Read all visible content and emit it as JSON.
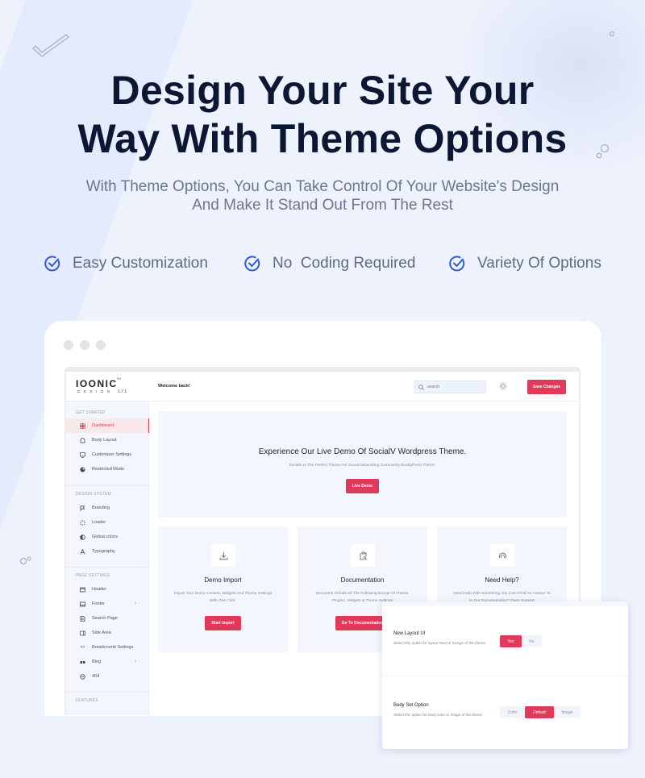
{
  "hero": {
    "title_line1": "Design Your Site Your",
    "title_line2": "Way With Theme Options",
    "subtitle_line1": "With Theme Options, You Can Take Control Of Your Website's Design",
    "subtitle_line2": "And Make It Stand Out From The Rest"
  },
  "features": [
    {
      "icon": "check-circle-icon",
      "label": "Easy Customization"
    },
    {
      "icon": "check-circle-icon",
      "label": "No  Coding Required"
    },
    {
      "icon": "check-circle-icon",
      "label": "Variety Of Options"
    }
  ],
  "colors": {
    "accent": "#e0395a",
    "feature_check": "#2d5bd7",
    "heading": "#0b1733",
    "background": "#eef2fc"
  },
  "app": {
    "logo": {
      "main": "IOONIC",
      "tm": "TM",
      "sub": "DESIGN",
      "version": "1.7.1"
    },
    "topbar": {
      "welcome": "Welcome back!",
      "search_placeholder": "search",
      "save_label": "Save Changes"
    },
    "sidebar": {
      "sections": [
        {
          "label": "GET STARTED",
          "items": [
            {
              "label": "Dashboard",
              "icon": "dashboard-icon",
              "active": true
            },
            {
              "label": "Body Layout",
              "icon": "body-layout-icon"
            },
            {
              "label": "Customizer Settings",
              "icon": "monitor-icon"
            },
            {
              "label": "Restricted Mode",
              "icon": "restricted-icon"
            }
          ]
        },
        {
          "label": "DESIGN SYSTEM",
          "items": [
            {
              "label": "Branding",
              "icon": "flag-icon"
            },
            {
              "label": "Loader",
              "icon": "loader-icon"
            },
            {
              "label": "Global colors",
              "icon": "contrast-icon"
            },
            {
              "label": "Typography",
              "icon": "typography-icon"
            }
          ]
        },
        {
          "label": "PAGE SETTINGS",
          "items": [
            {
              "label": "Header",
              "icon": "header-icon"
            },
            {
              "label": "Footer",
              "icon": "footer-icon",
              "chevron": "›"
            },
            {
              "label": "Search Page",
              "icon": "search-page-icon"
            },
            {
              "label": "Side Area",
              "icon": "side-area-icon"
            },
            {
              "label": "Breadcrumb Settings",
              "icon": "code-icon"
            },
            {
              "label": "Blog",
              "icon": "blog-icon",
              "chevron": "›"
            },
            {
              "label": "404",
              "icon": "error-icon"
            }
          ]
        },
        {
          "label": "FEATURES",
          "items": []
        }
      ]
    },
    "hero_card": {
      "title": "Experience Our Live Demo Of SocialV Wordpress Theme.",
      "description": "SocialV Is The Perfect Theme For Social Networking Community BuddyPress Theme.",
      "button": "Live Demo"
    },
    "cards": [
      {
        "title": "Demo Import",
        "description": "Import Your Demo Content, Widgets And Theme Settings With One Click.",
        "button": "Start Import",
        "icon": "download-icon"
      },
      {
        "title": "Documentation",
        "description": "Document Include All The Following Except Of Theme, Plugins, Widgets & Theme Settings",
        "button": "Go To Documentation",
        "icon": "clipboard-search-icon"
      },
      {
        "title": "Need Help?",
        "description": "Need Help With Something You Can't Find An Answer To In Our Documentation? Open Support",
        "button": "",
        "icon": "headset-icon"
      }
    ]
  },
  "options_panel": {
    "new_layout": {
      "title": "New Layout UI",
      "description": "Select this option for layout New UI Design of the theme.",
      "options": [
        "Yes",
        "No"
      ],
      "selected": "Yes"
    },
    "body_set": {
      "title": "Body Set Option",
      "description": "Select this option for body color or image of the theme.",
      "options": [
        "Color",
        "Default",
        "Image"
      ],
      "selected": "Default"
    }
  }
}
